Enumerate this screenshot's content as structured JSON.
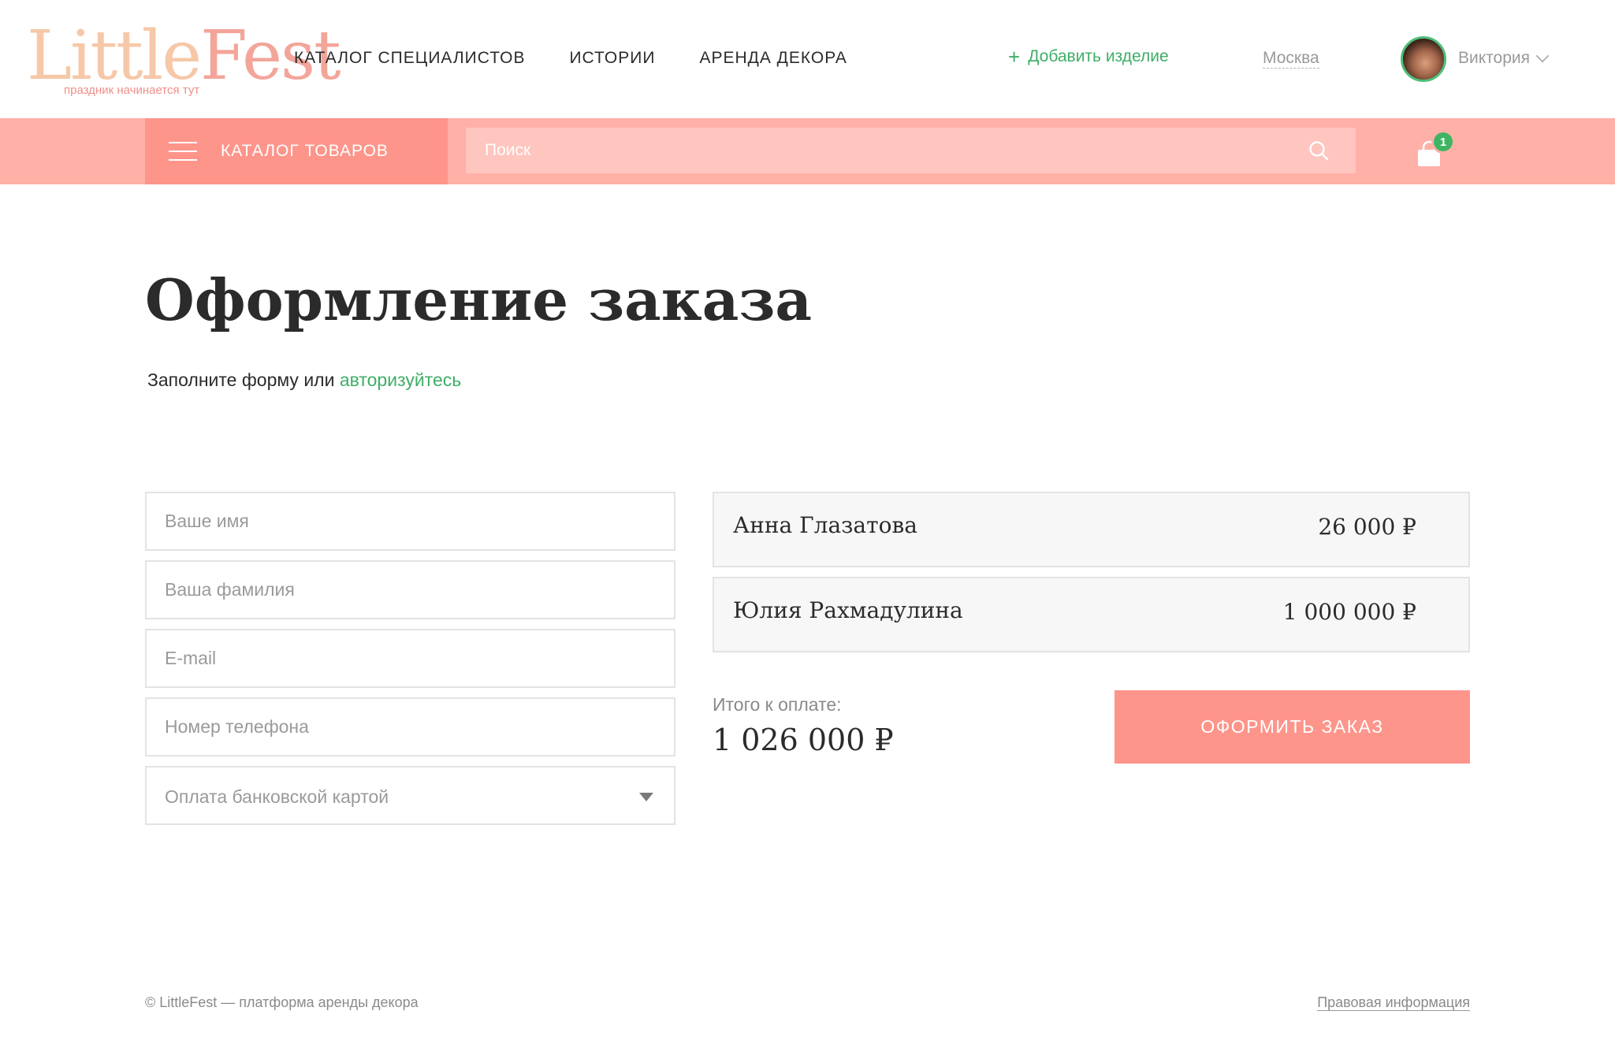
{
  "header": {
    "logo": {
      "part1": "Little",
      "part2": "Fest",
      "tagline": "праздник начинается тут"
    },
    "nav": [
      {
        "label": "КАТАЛОГ СПЕЦИАЛИСТОВ"
      },
      {
        "label": "ИСТОРИИ"
      },
      {
        "label": "АРЕНДА ДЕКОРА"
      }
    ],
    "add_item": {
      "icon": "plus-icon",
      "label": "Добавить изделие"
    },
    "city": "Москва",
    "user": {
      "name": "Виктория",
      "icon": "chevron-down-icon"
    }
  },
  "toolbar": {
    "catalog_label": "КАТАЛОГ ТОВАРОВ",
    "search_placeholder": "Поиск",
    "search_icon": "search-icon",
    "cart_icon": "shopping-bag-icon",
    "cart_count": "1"
  },
  "page": {
    "title": "Оформление заказа",
    "subtitle_text": "Заполните форму или ",
    "subtitle_link": "авторизуйтесь"
  },
  "form": {
    "name_placeholder": "Ваше имя",
    "surname_placeholder": "Ваша фамилия",
    "email_placeholder": "E-mail",
    "phone_placeholder": "Номер телефона",
    "payment": {
      "selected": "Оплата банковской картой"
    }
  },
  "order": {
    "items": [
      {
        "name": "Анна Глазатова",
        "price": "26 000 ₽"
      },
      {
        "name": "Юлия Рахмадулина",
        "price": "1 000 000 ₽"
      }
    ],
    "total_label": "Итого к оплате:",
    "total_value": "1 026 000 ₽",
    "submit_label": "ОФОРМИТЬ ЗАКАЗ"
  },
  "footer": {
    "copyright": "© LittleFest — платформа аренды декора",
    "legal_link": "Правовая информация"
  },
  "colors": {
    "accent_pink": "#fe958b",
    "bar_pink": "#ffb0a7",
    "green": "#3fae67"
  }
}
